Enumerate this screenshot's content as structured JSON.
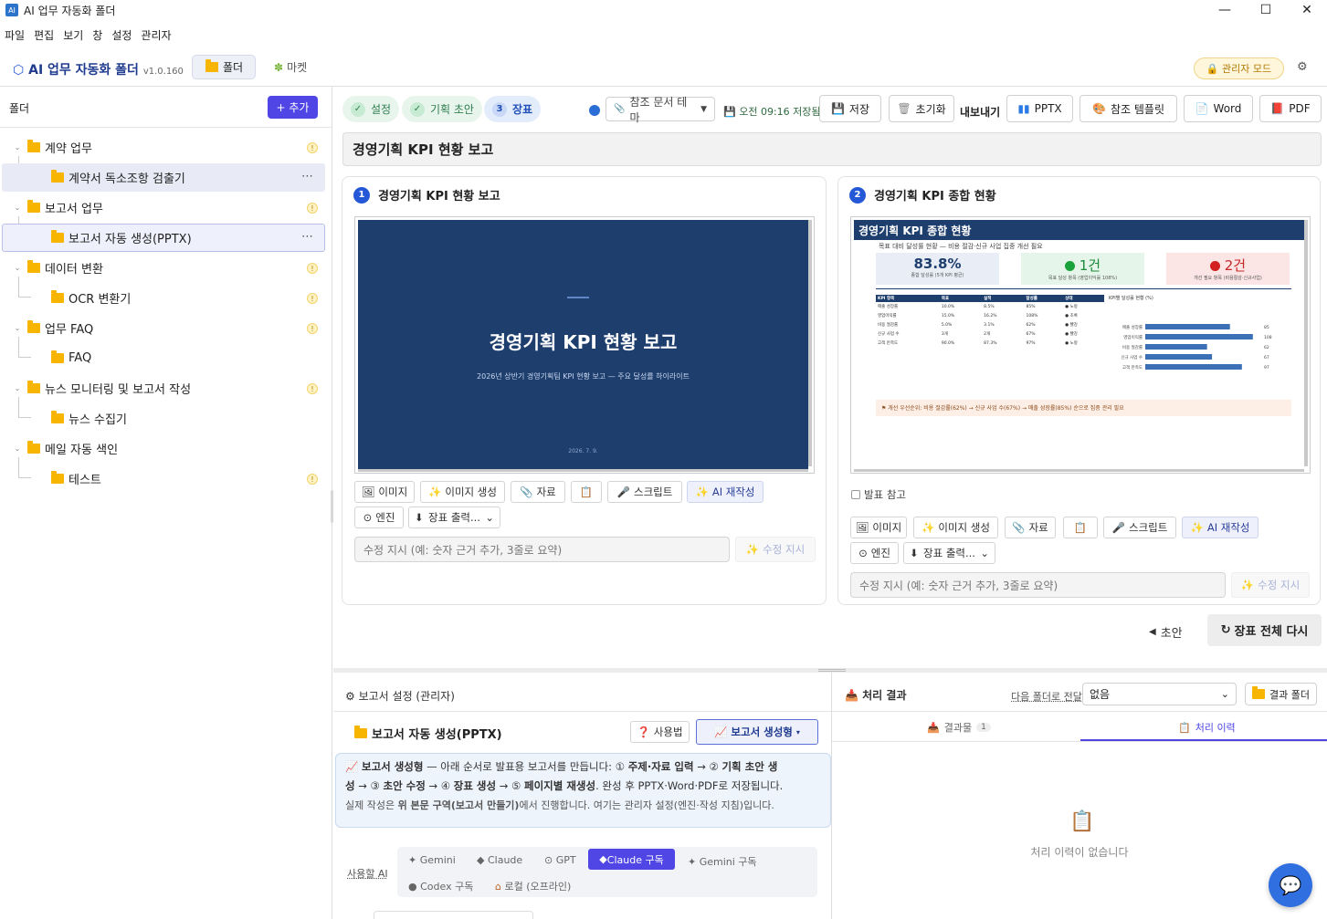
{
  "window": {
    "title": "AI 업무 자동화 폴더",
    "minimize": "—",
    "maximize": "☐",
    "close": "✕"
  },
  "menu": [
    "파일",
    "편집",
    "보기",
    "창",
    "설정",
    "관리자"
  ],
  "header": {
    "brand": "AI 업무 자동화 폴더",
    "version": "v1.0.160",
    "tab_folder": "폴더",
    "tab_market": "마켓",
    "admin_mode": "관리자 모드",
    "gear": "⚙"
  },
  "sidebar": {
    "title": "폴더",
    "add_label": "+ 추가",
    "items": [
      {
        "label": "계약 업무",
        "level": 0,
        "caret": "⌄"
      },
      {
        "label": "계약서 독소조항 검출기",
        "level": 1
      },
      {
        "label": "보고서 업무",
        "level": 0,
        "caret": "⌄"
      },
      {
        "label": "보고서 자동 생성(PPTX)",
        "level": 1
      },
      {
        "label": "데이터 변환",
        "level": 0,
        "caret": "⌄"
      },
      {
        "label": "OCR 변환기",
        "level": 1
      },
      {
        "label": "업무 FAQ",
        "level": 0,
        "caret": "⌄"
      },
      {
        "label": "FAQ",
        "level": 1
      },
      {
        "label": "뉴스 모니터링 및 보고서 작성",
        "level": 0,
        "caret": "⌄"
      },
      {
        "label": "뉴스 수집기",
        "level": 1
      },
      {
        "label": "메일 자동 색인",
        "level": 0,
        "caret": "⌄"
      },
      {
        "label": "테스트",
        "level": 1
      }
    ]
  },
  "steps": [
    {
      "label": "설정",
      "mark": "✓"
    },
    {
      "label": "기획 초안",
      "mark": "✓"
    },
    {
      "label": "장표",
      "mark": "3"
    }
  ],
  "toolbar": {
    "theme_select": "참조 문서 테마",
    "saved_status": "오전 09:16 저장됨",
    "save": "저장",
    "reset": "초기화",
    "export_label": "내보내기",
    "pptx": "PPTX",
    "ref_template": "참조 템플릿",
    "word": "Word",
    "pdf": "PDF"
  },
  "doc_title": "경영기획 KPI 현황 보고",
  "slide1": {
    "num": "1",
    "title": "경영기획 KPI 현황 보고",
    "main_title": "경영기획 KPI 현황 보고",
    "subtitle": "2026년 상반기 경영기획팀 KPI 현황 보고 — 주요 달성률 하이라이트",
    "date": "2026. 7. 9."
  },
  "slide2": {
    "num": "2",
    "title": "경영기획 KPI 종합 현황",
    "header": "경영기획 KPI 종합 현황",
    "subline": "목표 대비 달성률 현황 — 비용 절감·신규 사업 집중 개선 필요",
    "kpi1_value": "83.8%",
    "kpi1_label": "종합 달성률 (5개 KPI 평균)",
    "kpi2_value": "1건",
    "kpi2_label": "목표 달성 항목 (영업이익률 108%)",
    "kpi3_value": "2건",
    "kpi3_label": "개선 필요 항목 (비용절감·신규사업)",
    "table_headers": [
      "KPI 항목",
      "목표",
      "실적",
      "달성률",
      "상태"
    ],
    "table_rows": [
      [
        "매출 성장률",
        "10.0%",
        "8.5%",
        "85%",
        "● 노랑"
      ],
      [
        "영업이익률",
        "15.0%",
        "16.2%",
        "108%",
        "● 초록"
      ],
      [
        "비용 절감률",
        "5.0%",
        "3.1%",
        "62%",
        "● 빨강"
      ],
      [
        "신규 사업 수",
        "3개",
        "2개",
        "67%",
        "● 빨강"
      ],
      [
        "고객 만족도",
        "90.0%",
        "87.3%",
        "97%",
        "● 노랑"
      ]
    ],
    "bar_title": "KPI별 달성률 현황 (%)",
    "bar_note": "⚑ 개선 우선순위: 비용 절감률(62%) → 신규 사업 수(67%) → 매출 성장률(85%) 순으로 집중 관리 필요",
    "ref_check": "발표 참고"
  },
  "chart_data": {
    "type": "bar",
    "title": "KPI별 달성률 현황 (%)",
    "categories": [
      "매출 성장률",
      "영업이익률",
      "비용 절감률",
      "신규 사업 수",
      "고객 만족도"
    ],
    "values": [
      85,
      108,
      62,
      67,
      97
    ],
    "xlim": [
      0,
      110
    ]
  },
  "slide_actions": {
    "image": "이미지",
    "image_gen": "이미지 생성",
    "material": "자료",
    "clipboard": "📋",
    "script": "스크립트",
    "ai_rewrite": "AI 재작성",
    "engine": "엔진",
    "slide_output": "장표 출력...",
    "edit_placeholder": "수정 지시 (예: 숫자 근거 추가, 3줄로 요약)",
    "edit_btn": "수정 지시"
  },
  "nav": {
    "back": "초안",
    "redo_all": "장표 전체 다시"
  },
  "settings": {
    "header": "보고서 설정 (관리자)",
    "folder_name": "보고서 자동 생성(PPTX)",
    "usage": "사용법",
    "type_btn": "보고서 생성형",
    "info_l1_a": "보고서 생성형",
    "info_l1_b": " — 아래 순서로 발표용 보고서를 만듭니다: ① ",
    "info_l1_c": "주제·자료 입력",
    "info_l1_d": " → ② ",
    "info_l1_e": "기획 초안 생",
    "info_l2_a": "성",
    "info_l2_b": " → ③ ",
    "info_l2_c": "초안 수정",
    "info_l2_d": " → ④ ",
    "info_l2_e": "장표 생성",
    "info_l2_f": " → ⑤ ",
    "info_l2_g": "페이지별 재생성",
    "info_l2_h": ". 완성 후 PPTX·Word·PDF로 저장됩니다.",
    "info_l3_a": "실제 작성은 ",
    "info_l3_b": "위 본문 구역(보고서 만들기)",
    "info_l3_c": "에서 진행합니다. 여기는 관리자 설정(엔진·작성 지침)입니다.",
    "ai_label": "사용할 AI",
    "ai_options": [
      "Gemini",
      "Claude",
      "GPT",
      "Claude 구독",
      "Gemini 구독",
      "Codex 구독",
      "로컬 (오프라인)"
    ]
  },
  "results": {
    "header": "처리 결과",
    "next_folder": "다음 폴더로 전달",
    "next_value": "없음",
    "result_folder": "결과 폴더",
    "tab_output": "결과물",
    "tab_output_count": "1",
    "tab_history": "처리 이력",
    "empty": "처리 이력이 없습니다"
  },
  "colors": {
    "accent": "#4f46e5",
    "navy": "#1e3f6e",
    "blue": "#2458d6"
  }
}
